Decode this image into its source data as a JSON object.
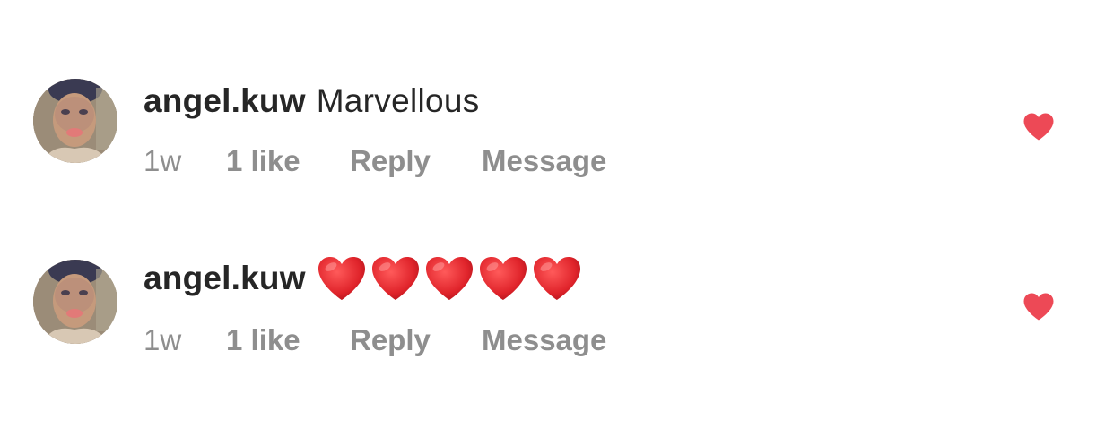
{
  "colors": {
    "username": "#262626",
    "meta_text": "#8e8e8e",
    "like_heart": "#ed4956",
    "emoji_heart": "#e0242b"
  },
  "comments": [
    {
      "username": "angel.kuw",
      "text": "Marvellous",
      "time": "1w",
      "likes": "1 like",
      "reply_label": "Reply",
      "message_label": "Message",
      "liked": true,
      "like_icon": "heart-filled-icon"
    },
    {
      "username": "angel.kuw",
      "text": "❤️❤️❤️❤️❤️",
      "emoji_hearts": 5,
      "time": "1w",
      "likes": "1 like",
      "reply_label": "Reply",
      "message_label": "Message",
      "liked": true,
      "like_icon": "heart-filled-icon"
    }
  ]
}
